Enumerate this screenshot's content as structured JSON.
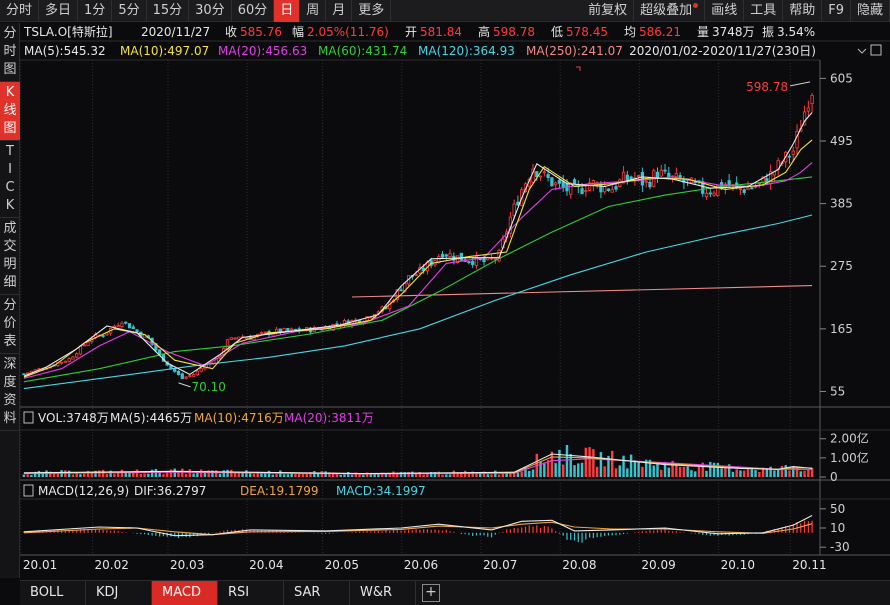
{
  "toolbar": {
    "periods": [
      "分时",
      "多日",
      "1分",
      "5分",
      "15分",
      "30分",
      "60分",
      "日",
      "周",
      "月",
      "更多"
    ],
    "active_period": "日",
    "actions": [
      "前复权",
      "超级叠加",
      "画线",
      "工具",
      "帮助",
      "F9",
      "隐藏"
    ]
  },
  "left_tabs": [
    {
      "label": "分\n时\n图",
      "active": false
    },
    {
      "label": "K\n线\n图",
      "active": true
    },
    {
      "label": "T\nI\nC\nK",
      "active": false
    },
    {
      "label": "成\n交\n明\n细",
      "active": false
    },
    {
      "label": "分\n价\n表",
      "active": false
    },
    {
      "label": "深\n度\n资\n料",
      "active": false
    }
  ],
  "header": {
    "symbol": "TSLA.O[特斯拉]",
    "date": "2020/11/27",
    "close_label": "收",
    "close": "585.76",
    "change_label": "幅",
    "change": "2.05%(11.76)",
    "open_label": "开",
    "open": "581.84",
    "high_label": "高",
    "high": "598.78",
    "low_label": "低",
    "low": "578.45",
    "avg_label": "均",
    "avg": "586.21",
    "vol_label": "量",
    "vol": "3748万",
    "amp_label": "振",
    "amp": "3.54%",
    "range": "2020/01/02-2020/11/27(230日)"
  },
  "ma_legend": [
    {
      "text": "MA(5):545.32",
      "color": "#e8e8e8"
    },
    {
      "text": "MA(10):497.07",
      "color": "#f2e23c"
    },
    {
      "text": "MA(20):456.63",
      "color": "#e040e6"
    },
    {
      "text": "MA(60):431.74",
      "color": "#2fcd3a"
    },
    {
      "text": "MA(120):364.93",
      "color": "#49d6e6"
    },
    {
      "text": "MA(250):241.07",
      "color": "#f08a8a"
    }
  ],
  "vol_legend": [
    {
      "text": "VOL:3748万",
      "color": "#e6e6e6"
    },
    {
      "text": "MA(5):4465万",
      "color": "#e6e6e6"
    },
    {
      "text": "MA(10):4716万",
      "color": "#f0a53c"
    },
    {
      "text": "MA(20):3811万",
      "color": "#e040e6"
    }
  ],
  "macd_legend": [
    {
      "text": "MACD(12,26,9)",
      "color": "#e6e6e6"
    },
    {
      "text": "DIF:36.2797",
      "color": "#e6e6e6"
    },
    {
      "text": "DEA:19.1799",
      "color": "#f0a53c"
    },
    {
      "text": "MACD:34.1997",
      "color": "#49d6e6"
    }
  ],
  "bottom_tabs": [
    "BOLL",
    "KDJ",
    "MACD",
    "RSI",
    "SAR",
    "W&R"
  ],
  "active_bottom_tab": "MACD",
  "colors": {
    "up": "#ff3b3b",
    "down": "#39c3cf",
    "grid": "#3a3a40",
    "ma250": "#f08a8a"
  },
  "chart_data": {
    "type": "candlestick",
    "price_axis": {
      "ticks": [
        605,
        495,
        385,
        275,
        165,
        55
      ],
      "range": [
        40,
        625
      ]
    },
    "volume_axis": {
      "ticks": [
        "2.00亿",
        "1.00亿",
        "0"
      ],
      "range": [
        0,
        2.3
      ]
    },
    "macd_axis": {
      "ticks": [
        "50",
        "10",
        "-30"
      ],
      "range": [
        -40,
        60
      ]
    },
    "x_ticks": [
      "20.01",
      "20.02",
      "20.03",
      "20.04",
      "20.05",
      "20.06",
      "20.07",
      "20.08",
      "20.09",
      "20.10",
      "20.11"
    ],
    "annotations": {
      "high": "598.78",
      "low": "70.10"
    },
    "close_series": [
      [
        0,
        86
      ],
      [
        5,
        96
      ],
      [
        12,
        112
      ],
      [
        18,
        150
      ],
      [
        21,
        155
      ],
      [
        26,
        180
      ],
      [
        30,
        160
      ],
      [
        33,
        148
      ],
      [
        36,
        118
      ],
      [
        39,
        96
      ],
      [
        42,
        78
      ],
      [
        45,
        85
      ],
      [
        48,
        100
      ],
      [
        51,
        110
      ],
      [
        54,
        143
      ],
      [
        57,
        152
      ],
      [
        60,
        150
      ],
      [
        66,
        160
      ],
      [
        72,
        162
      ],
      [
        78,
        165
      ],
      [
        84,
        175
      ],
      [
        90,
        182
      ],
      [
        93,
        195
      ],
      [
        96,
        201
      ],
      [
        99,
        230
      ],
      [
        102,
        255
      ],
      [
        105,
        265
      ],
      [
        108,
        282
      ],
      [
        111,
        300
      ],
      [
        114,
        292
      ],
      [
        117,
        288
      ],
      [
        120,
        285
      ],
      [
        123,
        282
      ],
      [
        126,
        295
      ],
      [
        129,
        360
      ],
      [
        132,
        410
      ],
      [
        135,
        450
      ],
      [
        138,
        432
      ],
      [
        141,
        418
      ],
      [
        144,
        410
      ],
      [
        147,
        408
      ],
      [
        150,
        422
      ],
      [
        153,
        415
      ],
      [
        156,
        412
      ],
      [
        159,
        428
      ],
      [
        162,
        430
      ],
      [
        165,
        420
      ],
      [
        168,
        440
      ],
      [
        171,
        430
      ],
      [
        174,
        425
      ],
      [
        177,
        418
      ],
      [
        180,
        408
      ],
      [
        183,
        410
      ],
      [
        186,
        420
      ],
      [
        189,
        410
      ],
      [
        192,
        412
      ],
      [
        195,
        418
      ],
      [
        198,
        435
      ],
      [
        201,
        458
      ],
      [
        204,
        478
      ],
      [
        206,
        525
      ],
      [
        208,
        570
      ],
      [
        209,
        586
      ]
    ],
    "ma250_series": [
      [
        87,
        221
      ],
      [
        209,
        241
      ]
    ],
    "ma120_series": [
      [
        0,
        60
      ],
      [
        25,
        82
      ],
      [
        45,
        100
      ],
      [
        65,
        115
      ],
      [
        85,
        135
      ],
      [
        105,
        165
      ],
      [
        125,
        215
      ],
      [
        145,
        260
      ],
      [
        165,
        300
      ],
      [
        185,
        330
      ],
      [
        200,
        350
      ],
      [
        209,
        365
      ]
    ],
    "ma60_series": [
      [
        0,
        72
      ],
      [
        20,
        95
      ],
      [
        40,
        125
      ],
      [
        55,
        135
      ],
      [
        75,
        155
      ],
      [
        95,
        180
      ],
      [
        110,
        230
      ],
      [
        125,
        285
      ],
      [
        140,
        335
      ],
      [
        155,
        380
      ],
      [
        170,
        400
      ],
      [
        185,
        415
      ],
      [
        200,
        425
      ],
      [
        209,
        432
      ]
    ],
    "ma20_series": [
      [
        0,
        78
      ],
      [
        10,
        95
      ],
      [
        20,
        135
      ],
      [
        28,
        160
      ],
      [
        38,
        125
      ],
      [
        48,
        100
      ],
      [
        58,
        140
      ],
      [
        72,
        160
      ],
      [
        90,
        175
      ],
      [
        102,
        205
      ],
      [
        112,
        280
      ],
      [
        122,
        290
      ],
      [
        132,
        360
      ],
      [
        140,
        410
      ],
      [
        150,
        420
      ],
      [
        162,
        425
      ],
      [
        172,
        432
      ],
      [
        184,
        418
      ],
      [
        194,
        415
      ],
      [
        202,
        425
      ],
      [
        206,
        440
      ],
      [
        209,
        457
      ]
    ],
    "ma10_series": [
      [
        0,
        80
      ],
      [
        8,
        100
      ],
      [
        16,
        140
      ],
      [
        24,
        165
      ],
      [
        32,
        155
      ],
      [
        40,
        110
      ],
      [
        50,
        95
      ],
      [
        56,
        140
      ],
      [
        65,
        158
      ],
      [
        80,
        165
      ],
      [
        92,
        180
      ],
      [
        100,
        225
      ],
      [
        108,
        280
      ],
      [
        118,
        292
      ],
      [
        128,
        300
      ],
      [
        134,
        410
      ],
      [
        138,
        450
      ],
      [
        146,
        415
      ],
      [
        156,
        420
      ],
      [
        166,
        430
      ],
      [
        176,
        428
      ],
      [
        186,
        410
      ],
      [
        196,
        418
      ],
      [
        202,
        440
      ],
      [
        206,
        480
      ],
      [
        209,
        497
      ]
    ],
    "ma5_series": [
      [
        0,
        82
      ],
      [
        6,
        98
      ],
      [
        14,
        130
      ],
      [
        22,
        170
      ],
      [
        30,
        158
      ],
      [
        38,
        105
      ],
      [
        44,
        85
      ],
      [
        52,
        120
      ],
      [
        58,
        150
      ],
      [
        70,
        160
      ],
      [
        84,
        172
      ],
      [
        94,
        190
      ],
      [
        100,
        240
      ],
      [
        108,
        288
      ],
      [
        118,
        290
      ],
      [
        126,
        290
      ],
      [
        132,
        395
      ],
      [
        136,
        455
      ],
      [
        144,
        420
      ],
      [
        154,
        415
      ],
      [
        164,
        432
      ],
      [
        172,
        428
      ],
      [
        182,
        412
      ],
      [
        192,
        415
      ],
      [
        200,
        445
      ],
      [
        204,
        490
      ],
      [
        207,
        530
      ],
      [
        209,
        545
      ]
    ],
    "volume_ma5": [
      [
        0,
        0.22
      ],
      [
        40,
        0.3
      ],
      [
        90,
        0.18
      ],
      [
        130,
        0.25
      ],
      [
        140,
        1.2
      ],
      [
        150,
        1.05
      ],
      [
        170,
        0.65
      ],
      [
        190,
        0.45
      ],
      [
        200,
        0.4
      ],
      [
        204,
        0.55
      ],
      [
        209,
        0.45
      ]
    ],
    "volume_ma10": [
      [
        0,
        0.2
      ],
      [
        40,
        0.28
      ],
      [
        90,
        0.17
      ],
      [
        130,
        0.22
      ],
      [
        140,
        1.05
      ],
      [
        150,
        1.0
      ],
      [
        170,
        0.7
      ],
      [
        190,
        0.48
      ],
      [
        200,
        0.4
      ],
      [
        204,
        0.48
      ],
      [
        209,
        0.47
      ]
    ],
    "volume_ma20": [
      [
        0,
        0.18
      ],
      [
        40,
        0.25
      ],
      [
        90,
        0.16
      ],
      [
        130,
        0.2
      ],
      [
        140,
        0.85
      ],
      [
        150,
        0.95
      ],
      [
        170,
        0.75
      ],
      [
        190,
        0.52
      ],
      [
        200,
        0.4
      ],
      [
        204,
        0.4
      ],
      [
        209,
        0.38
      ]
    ],
    "macd_dif": [
      [
        0,
        2
      ],
      [
        20,
        12
      ],
      [
        30,
        10
      ],
      [
        40,
        -6
      ],
      [
        50,
        -4
      ],
      [
        60,
        6
      ],
      [
        80,
        4
      ],
      [
        100,
        10
      ],
      [
        110,
        18
      ],
      [
        124,
        6
      ],
      [
        132,
        24
      ],
      [
        140,
        26
      ],
      [
        146,
        4
      ],
      [
        156,
        6
      ],
      [
        170,
        10
      ],
      [
        184,
        -2
      ],
      [
        196,
        0
      ],
      [
        204,
        16
      ],
      [
        209,
        36
      ]
    ],
    "macd_dea": [
      [
        0,
        0
      ],
      [
        20,
        8
      ],
      [
        30,
        10
      ],
      [
        40,
        2
      ],
      [
        50,
        -4
      ],
      [
        60,
        2
      ],
      [
        80,
        3
      ],
      [
        100,
        7
      ],
      [
        110,
        14
      ],
      [
        124,
        10
      ],
      [
        132,
        18
      ],
      [
        140,
        22
      ],
      [
        146,
        12
      ],
      [
        156,
        8
      ],
      [
        170,
        8
      ],
      [
        184,
        2
      ],
      [
        196,
        -1
      ],
      [
        204,
        8
      ],
      [
        209,
        19
      ]
    ],
    "macd_hist": [
      [
        0,
        4
      ],
      [
        10,
        6
      ],
      [
        18,
        9
      ],
      [
        24,
        4
      ],
      [
        30,
        -2
      ],
      [
        36,
        -8
      ],
      [
        42,
        -10
      ],
      [
        48,
        -4
      ],
      [
        54,
        6
      ],
      [
        60,
        8
      ],
      [
        70,
        2
      ],
      [
        80,
        -2
      ],
      [
        90,
        3
      ],
      [
        100,
        6
      ],
      [
        106,
        8
      ],
      [
        112,
        6
      ],
      [
        118,
        -6
      ],
      [
        124,
        -8
      ],
      [
        128,
        6
      ],
      [
        132,
        12
      ],
      [
        136,
        14
      ],
      [
        140,
        10
      ],
      [
        144,
        -14
      ],
      [
        148,
        -18
      ],
      [
        152,
        -8
      ],
      [
        158,
        -4
      ],
      [
        164,
        4
      ],
      [
        170,
        6
      ],
      [
        176,
        0
      ],
      [
        182,
        -6
      ],
      [
        188,
        -5
      ],
      [
        194,
        -2
      ],
      [
        198,
        6
      ],
      [
        202,
        14
      ],
      [
        206,
        24
      ],
      [
        209,
        34
      ]
    ]
  }
}
